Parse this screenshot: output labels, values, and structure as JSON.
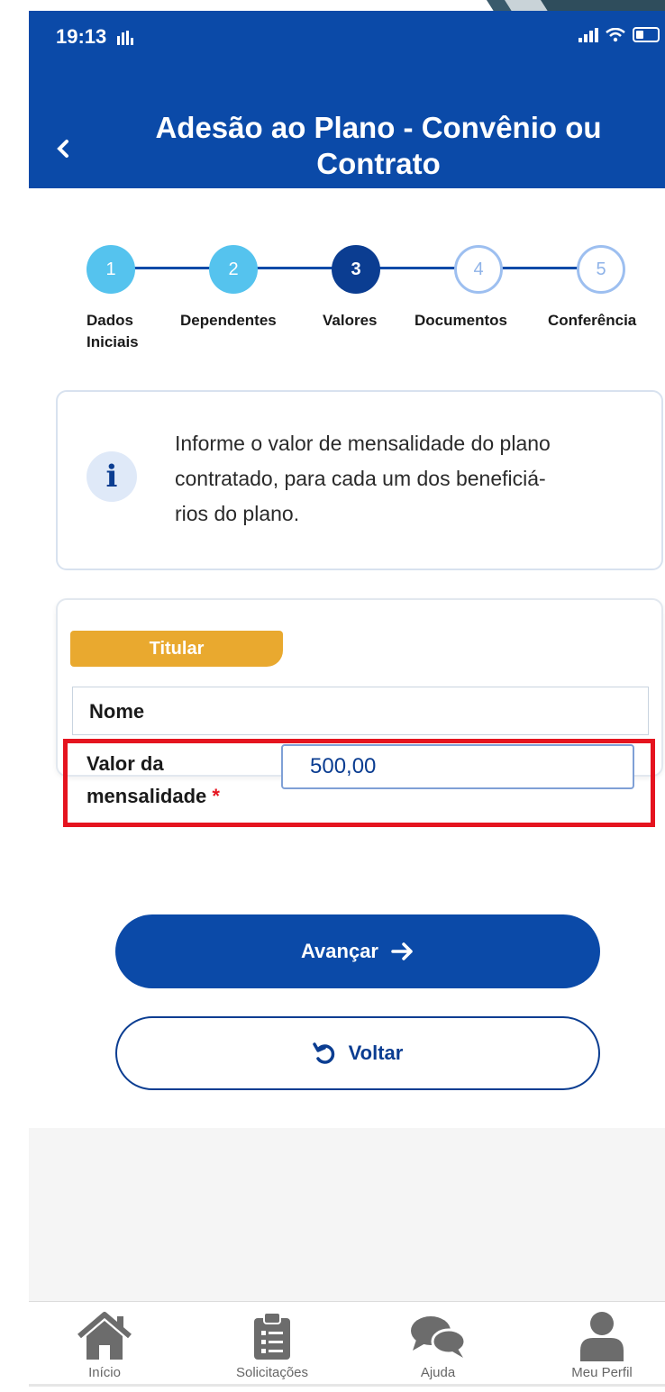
{
  "status_bar": {
    "time": "19:13"
  },
  "header": {
    "title": "Adesão ao Plano - Convênio ou Contrato",
    "back_icon": "chevron-left-icon"
  },
  "stepper": {
    "steps": [
      {
        "number": "1",
        "label_line1": "Dados",
        "label_line2": "Iniciais",
        "state": "done"
      },
      {
        "number": "2",
        "label_line1": "Dependentes",
        "label_line2": "",
        "state": "done"
      },
      {
        "number": "3",
        "label_line1": "Valores",
        "label_line2": "",
        "state": "current"
      },
      {
        "number": "4",
        "label_line1": "Documentos",
        "label_line2": "",
        "state": "todo"
      },
      {
        "number": "5",
        "label_line1": "Conferência",
        "label_line2": "",
        "state": "todo"
      }
    ]
  },
  "info": {
    "icon": "info-icon",
    "icon_glyph": "i",
    "line1": "Informe o valor de mensalidade do plano",
    "line2": "contratado, para cada um dos beneficiá-",
    "line3": "rios do plano."
  },
  "holder": {
    "tag": "Titular",
    "name_label": "Nome",
    "fee_label_line1": "Valor da",
    "fee_label_line2": "mensalidade",
    "required_mark": "*",
    "fee_value": "500,00"
  },
  "actions": {
    "next_label": "Avançar",
    "back_label": "Voltar"
  },
  "nav": {
    "items": [
      {
        "label": "Início",
        "icon": "home-icon"
      },
      {
        "label": "Solicitações",
        "icon": "clipboard-icon"
      },
      {
        "label": "Ajuda",
        "icon": "chat-icon"
      },
      {
        "label": "Meu Perfil",
        "icon": "user-icon"
      }
    ]
  },
  "colors": {
    "brand": "#0b4aa8",
    "step_done": "#55c3ee",
    "tag": "#e9a92f",
    "highlight": "#e5141f"
  }
}
